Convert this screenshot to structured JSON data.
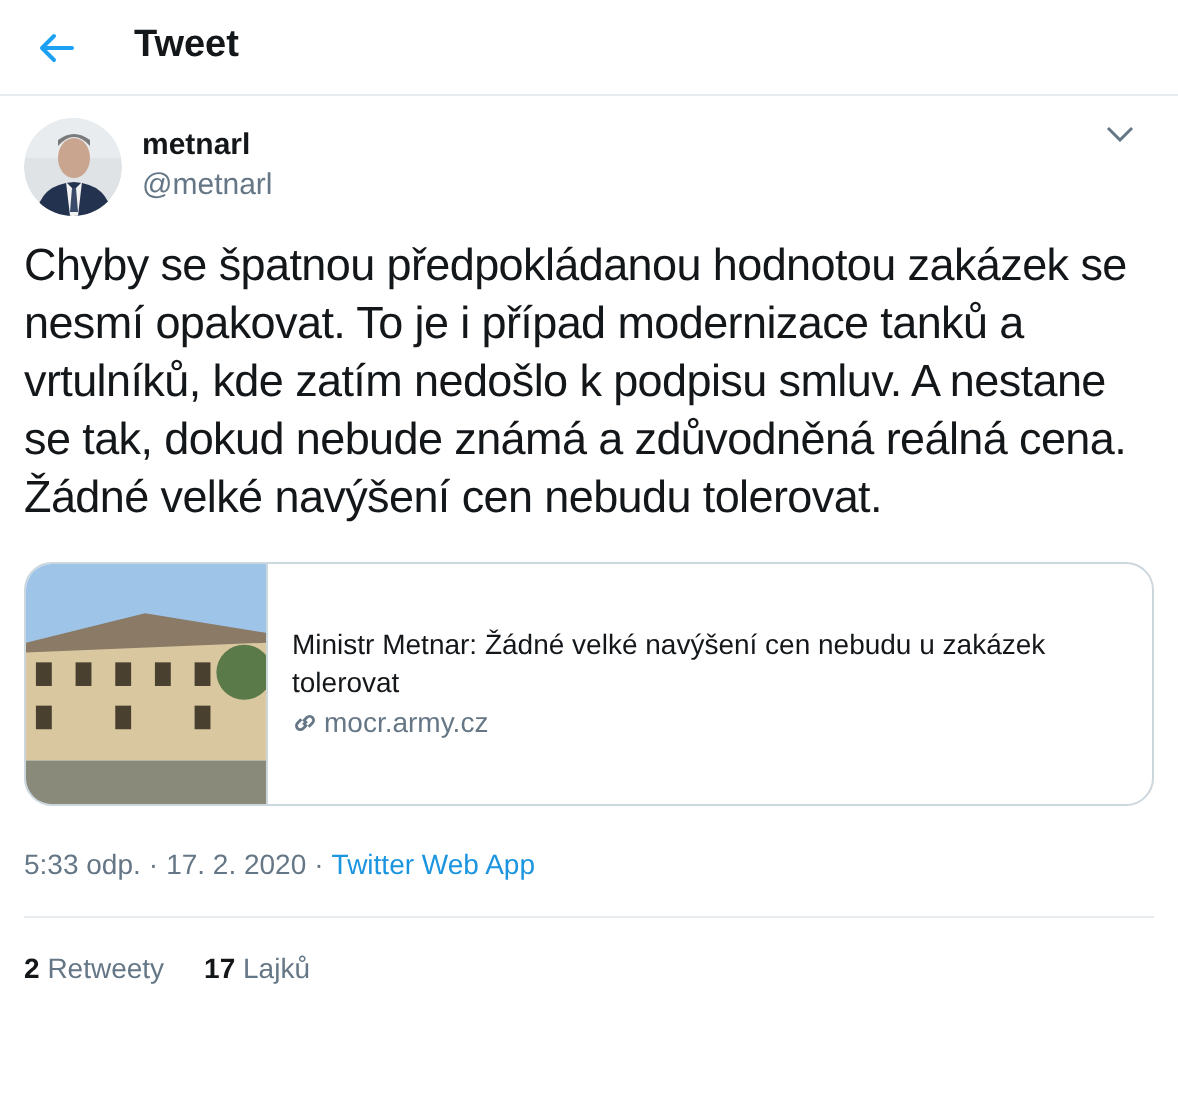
{
  "header": {
    "title": "Tweet"
  },
  "author": {
    "name": "metnarl",
    "handle": "@metnarl"
  },
  "tweet": {
    "text": "Chyby se špatnou předpokládanou hodnotou zakázek se nesmí opakovat. To je i případ modernizace tanků a vrtulníků, kde zatím nedošlo k podpisu smluv. A nestane se tak, dokud nebude známá a zdůvodněná reálná cena. Žádné velké navýšení cen nebudu tolerovat."
  },
  "link_card": {
    "title": "Ministr Metnar: Žádné velké navýšení cen nebudu u zakázek tolerovat",
    "domain": "mocr.army.cz"
  },
  "meta": {
    "time": "5:33 odp.",
    "separator_1": "·",
    "date": "17. 2. 2020",
    "separator_2": "·",
    "source": "Twitter Web App"
  },
  "stats": [
    {
      "count": "2",
      "label": "Retweety"
    },
    {
      "count": "17",
      "label": "Lajků"
    }
  ]
}
